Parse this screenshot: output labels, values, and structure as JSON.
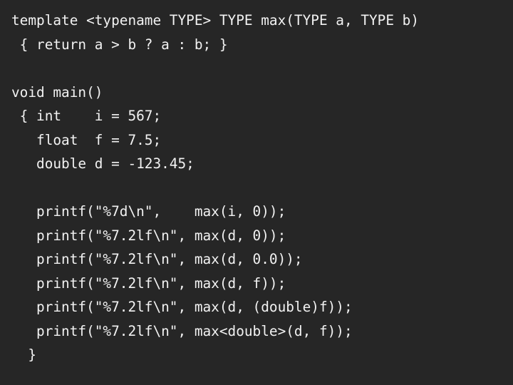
{
  "slide": {
    "background_color": "#262626",
    "text_color": "#f2f2f2",
    "code_lines": [
      "template <typename TYPE> TYPE max(TYPE a, TYPE b)",
      " { return a > b ? a : b; }",
      "",
      "void main()",
      " { int    i = 567;",
      "   float  f = 7.5;",
      "   double d = -123.45;",
      "",
      "   printf(\"%7d\\n\",    max(i, 0));",
      "   printf(\"%7.2lf\\n\", max(d, 0));",
      "   printf(\"%7.2lf\\n\", max(d, 0.0));",
      "   printf(\"%7.2lf\\n\", max(d, f));",
      "   printf(\"%7.2lf\\n\", max(d, (double)f));",
      "   printf(\"%7.2lf\\n\", max<double>(d, f));",
      "  }"
    ]
  }
}
